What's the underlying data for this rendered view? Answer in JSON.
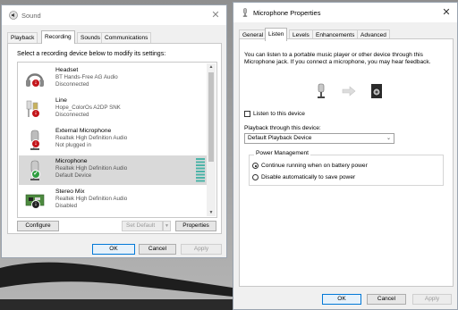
{
  "sound_window": {
    "title": "Sound",
    "close_glyph": "✕",
    "tabs": [
      "Playback",
      "Recording",
      "Sounds",
      "Communications"
    ],
    "active_tab": "Recording",
    "instruction": "Select a recording device below to modify its settings:",
    "devices": [
      {
        "name": "Headset",
        "sub": "BT Hands-Free AG Audio",
        "status": "Disconnected",
        "icon": "headset-icon",
        "badge": "down-arrow-red"
      },
      {
        "name": "Line",
        "sub": "Hope_ColorOs A2DP SNK",
        "status": "Disconnected",
        "icon": "line-in-icon",
        "badge": "down-arrow-red"
      },
      {
        "name": "External Microphone",
        "sub": "Realtek High Definition Audio",
        "status": "Not plugged in",
        "icon": "microphone-icon",
        "badge": "down-arrow-red"
      },
      {
        "name": "Microphone",
        "sub": "Realtek High Definition Audio",
        "status": "Default Device",
        "icon": "microphone-icon",
        "badge": "check-green",
        "selected": true
      },
      {
        "name": "Stereo Mix",
        "sub": "Realtek High Definition Audio",
        "status": "Disabled",
        "icon": "sound-card-icon",
        "badge": "down-arrow-black"
      }
    ],
    "buttons": {
      "configure": "Configure",
      "set_default": "Set Default",
      "properties": "Properties",
      "ok": "OK",
      "cancel": "Cancel",
      "apply": "Apply"
    }
  },
  "properties_window": {
    "title": "Microphone Properties",
    "close_glyph": "✕",
    "tabs": [
      "General",
      "Listen",
      "Levels",
      "Enhancements",
      "Advanced"
    ],
    "active_tab": "Listen",
    "description": "You can listen to a portable music player or other device through this Microphone jack.  If you connect a microphone, you may hear feedback.",
    "listen_checkbox_label": "Listen to this device",
    "listen_checked": false,
    "playback_label": "Playback through this device:",
    "playback_value": "Default Playback Device",
    "power_group_title": "Power Management",
    "power_options": [
      "Continue running when on battery power",
      "Disable automatically to save power"
    ],
    "power_selected": 0,
    "buttons": {
      "ok": "OK",
      "cancel": "Cancel",
      "apply": "Apply"
    }
  }
}
